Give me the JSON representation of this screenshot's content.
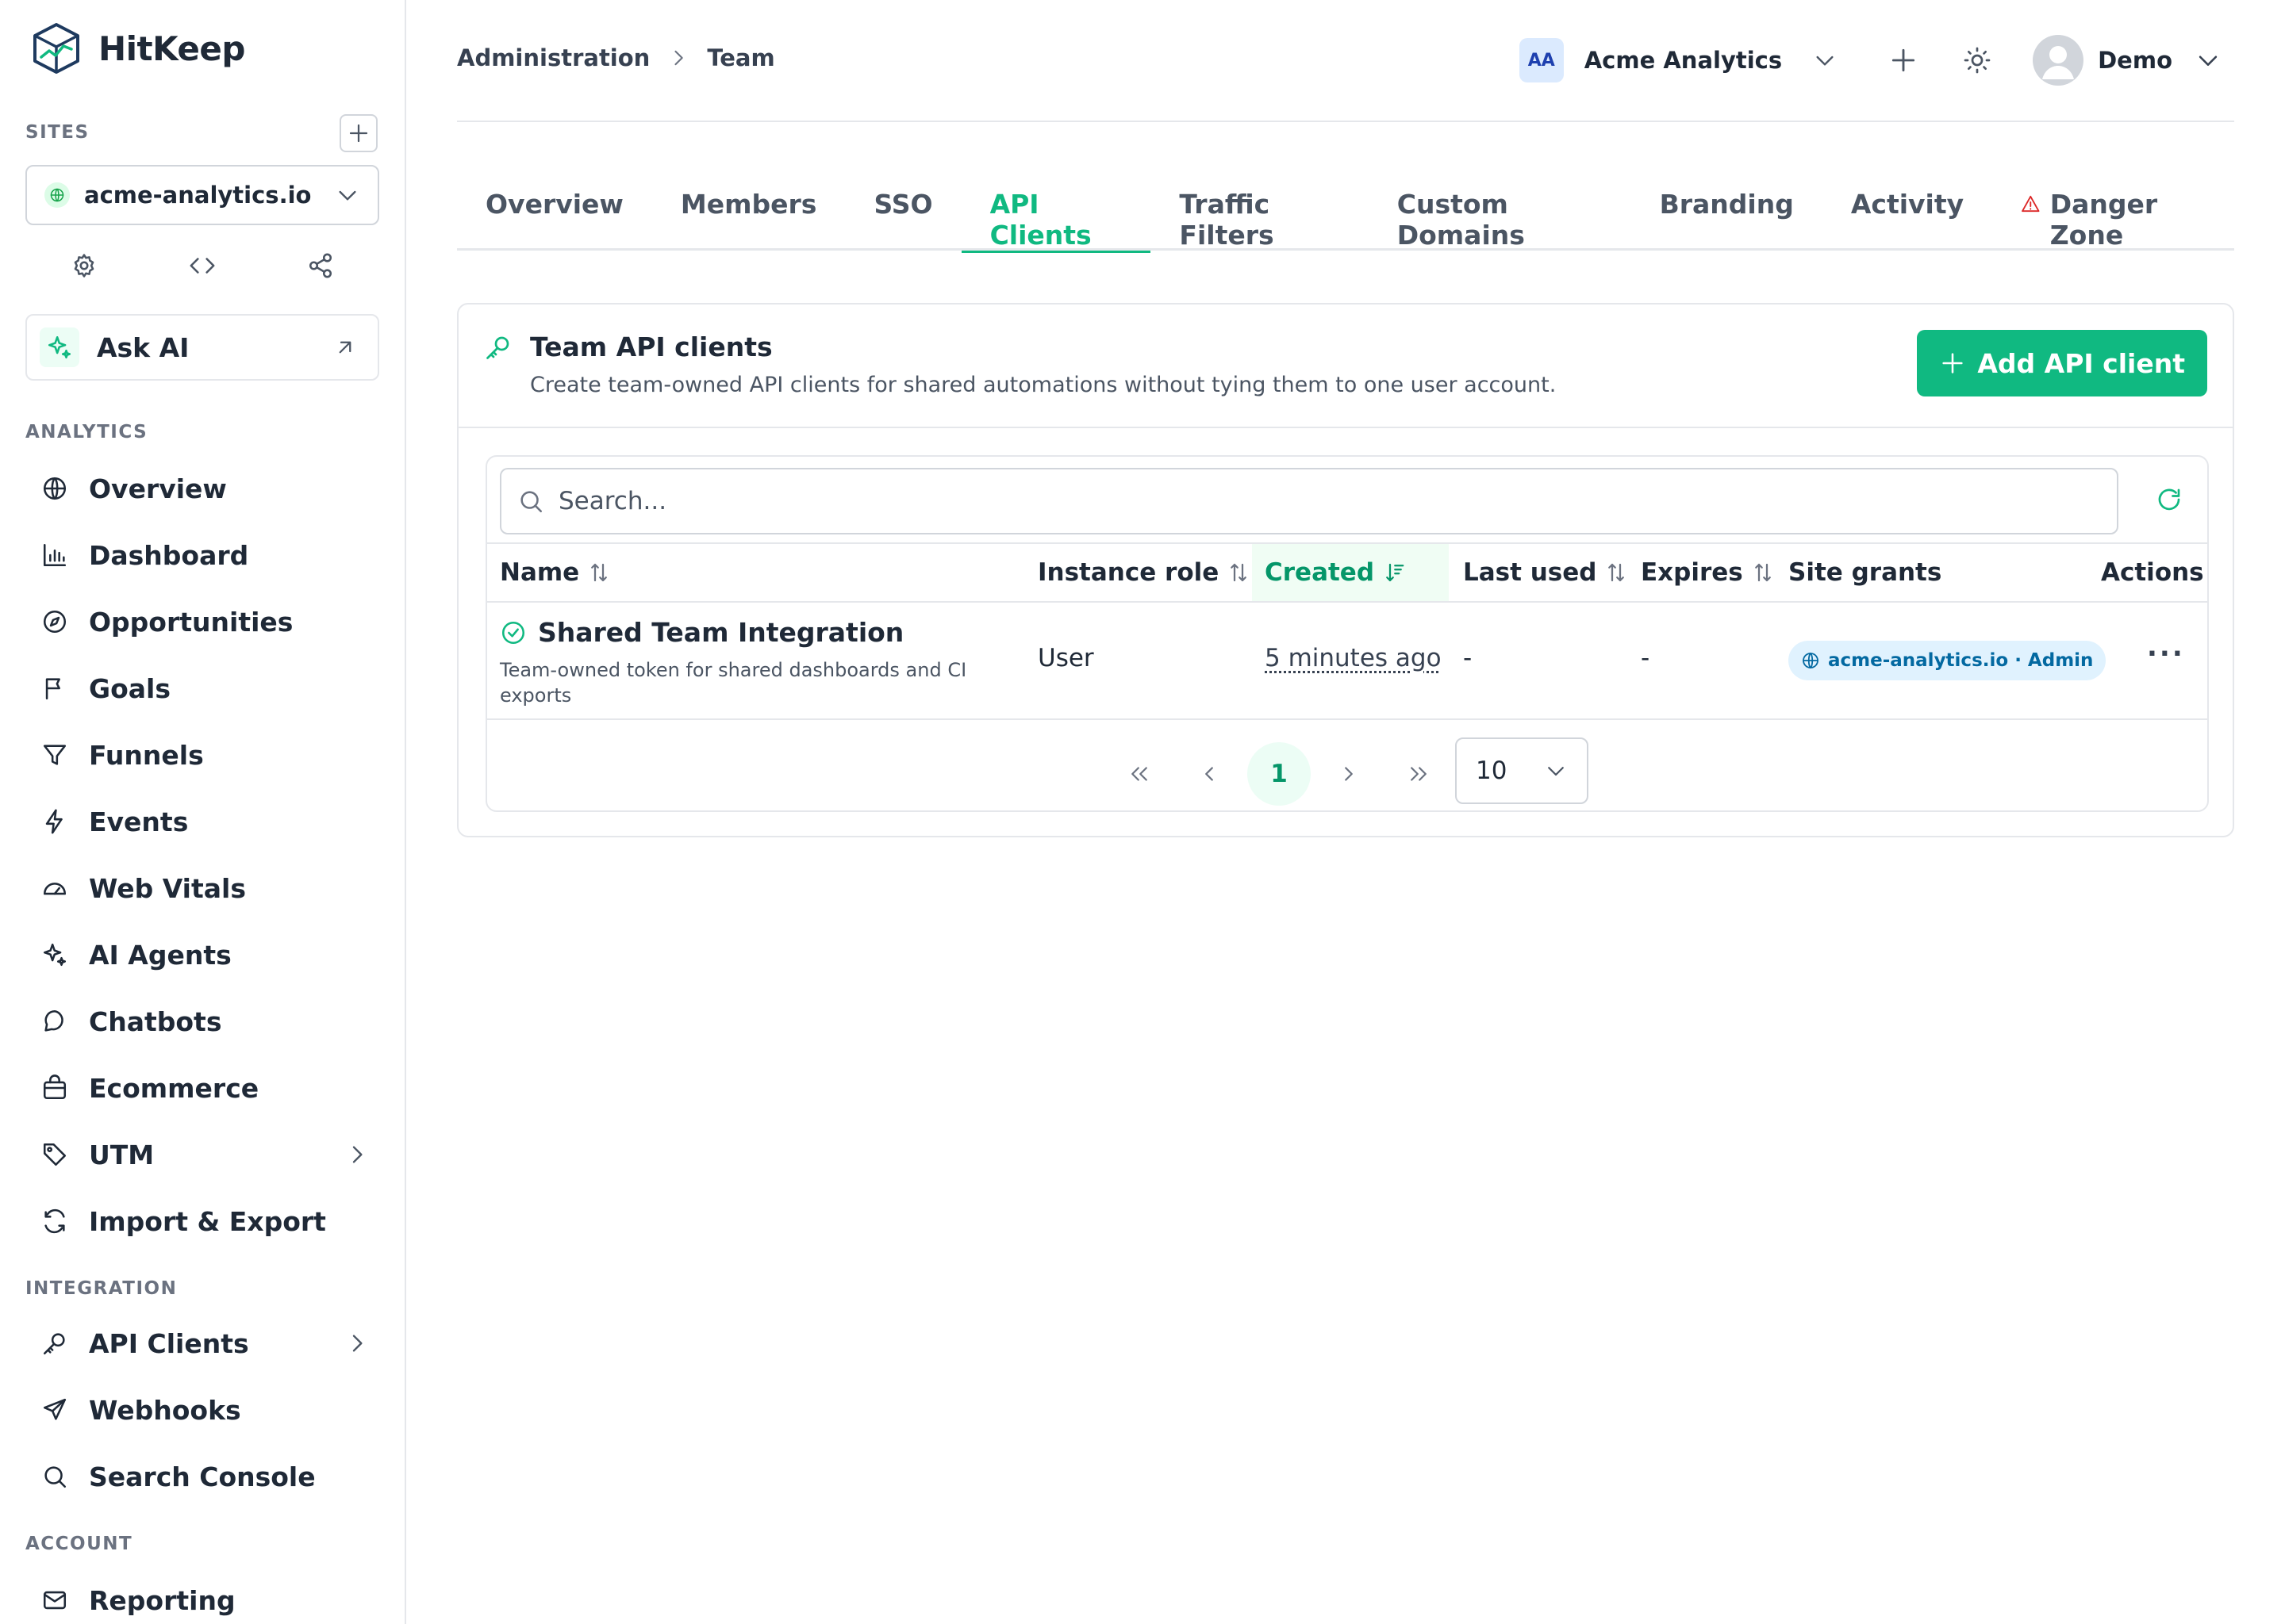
{
  "app": {
    "name": "HitKeep",
    "brand_color": "#10b981"
  },
  "sidebar": {
    "sites_label": "SITES",
    "selected_site": "acme-analytics.io",
    "ask_ai_label": "Ask AI",
    "analytics_label": "ANALYTICS",
    "analytics_items": [
      {
        "label": "Overview",
        "icon": "globe-icon"
      },
      {
        "label": "Dashboard",
        "icon": "bar-chart-icon"
      },
      {
        "label": "Opportunities",
        "icon": "compass-icon"
      },
      {
        "label": "Goals",
        "icon": "flag-icon"
      },
      {
        "label": "Funnels",
        "icon": "funnel-icon"
      },
      {
        "label": "Events",
        "icon": "bolt-icon"
      },
      {
        "label": "Web Vitals",
        "icon": "gauge-icon"
      },
      {
        "label": "AI Agents",
        "icon": "sparkles-icon"
      },
      {
        "label": "Chatbots",
        "icon": "chat-icon"
      },
      {
        "label": "Ecommerce",
        "icon": "shopping-bag-icon"
      },
      {
        "label": "UTM",
        "icon": "tag-icon"
      },
      {
        "label": "Import & Export",
        "icon": "sync-icon"
      }
    ],
    "integration_label": "INTEGRATION",
    "integration_items": [
      {
        "label": "API Clients",
        "icon": "key-icon"
      },
      {
        "label": "Webhooks",
        "icon": "send-icon"
      },
      {
        "label": "Search Console",
        "icon": "search-icon"
      }
    ],
    "account_label": "ACCOUNT",
    "account_items": [
      {
        "label": "Reporting",
        "icon": "mail-icon"
      }
    ]
  },
  "header": {
    "breadcrumb": [
      "Administration",
      "Team"
    ],
    "org_initials": "AA",
    "org_name": "Acme Analytics",
    "user_name": "Demo"
  },
  "tabs": [
    {
      "label": "Overview"
    },
    {
      "label": "Members"
    },
    {
      "label": "SSO"
    },
    {
      "label": "API Clients",
      "active": true
    },
    {
      "label": "Traffic Filters"
    },
    {
      "label": "Custom Domains"
    },
    {
      "label": "Branding"
    },
    {
      "label": "Activity"
    },
    {
      "label": "Danger Zone",
      "icon": "warning-icon"
    }
  ],
  "card": {
    "title": "Team API clients",
    "description": "Create team-owned API clients for shared automations without tying them to one user account.",
    "add_button_label": "Add API client",
    "search_placeholder": "Search...",
    "columns": [
      "Name",
      "Instance role",
      "Created",
      "Last used",
      "Expires",
      "Site grants",
      "Actions"
    ],
    "rows": [
      {
        "name": "Shared Team Integration",
        "description": "Team-owned token for shared dashboards and CI exports",
        "instance_role": "User",
        "created": "5 minutes ago",
        "last_used": "-",
        "expires": "-",
        "site_grant": "acme-analytics.io · Admin",
        "actions": "..."
      }
    ],
    "pagination": {
      "current_page": "1",
      "page_size": "10"
    }
  }
}
